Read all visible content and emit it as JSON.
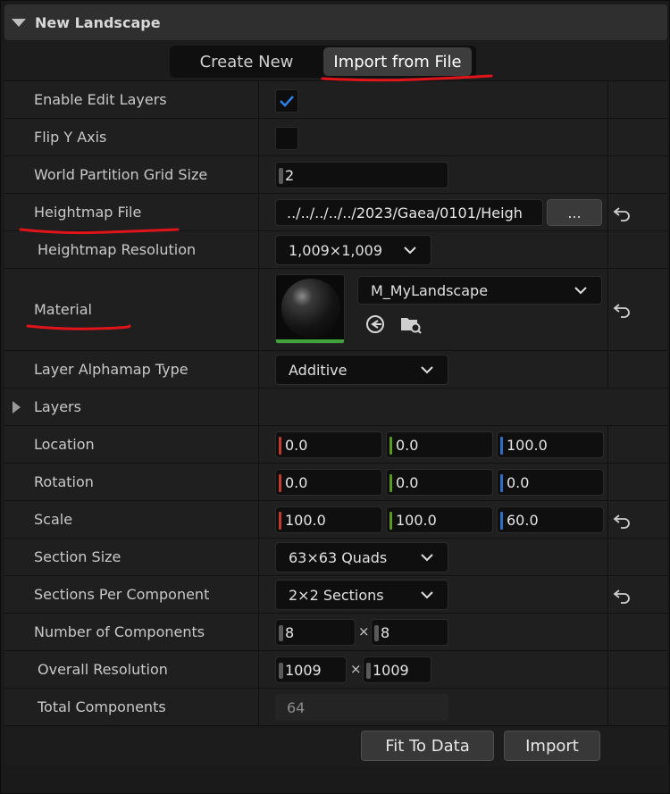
{
  "header": {
    "title": "New Landscape"
  },
  "tabs": [
    {
      "label": "Create New"
    },
    {
      "label": "Import from File"
    }
  ],
  "rows": {
    "enable_edit_layers": {
      "label": "Enable Edit Layers",
      "checked": true
    },
    "flip_y_axis": {
      "label": "Flip Y Axis",
      "checked": false
    },
    "wp_grid_size": {
      "label": "World Partition Grid Size",
      "value": "2"
    },
    "heightmap_file": {
      "label": "Heightmap File",
      "value": "../../../../../2023/Gaea/0101/Heigh",
      "browse_label": "..."
    },
    "heightmap_resolution": {
      "label": "Heightmap Resolution",
      "value": "1,009×1,009"
    },
    "material": {
      "label": "Material",
      "value": "M_MyLandscape"
    },
    "layer_alphamap_type": {
      "label": "Layer Alphamap Type",
      "value": "Additive"
    },
    "layers": {
      "label": "Layers"
    },
    "location": {
      "label": "Location",
      "x": "0.0",
      "y": "0.0",
      "z": "100.0"
    },
    "rotation": {
      "label": "Rotation",
      "x": "0.0",
      "y": "0.0",
      "z": "0.0"
    },
    "scale": {
      "label": "Scale",
      "x": "100.0",
      "y": "100.0",
      "z": "60.0"
    },
    "section_size": {
      "label": "Section Size",
      "value": "63×63 Quads"
    },
    "sections_per_component": {
      "label": "Sections Per Component",
      "value": "2×2 Sections"
    },
    "number_of_components": {
      "label": "Number of Components",
      "x": "8",
      "y": "8",
      "sep": "×"
    },
    "overall_resolution": {
      "label": "Overall Resolution",
      "x": "1009",
      "y": "1009",
      "sep": "×"
    },
    "total_components": {
      "label": "Total Components",
      "value": "64"
    }
  },
  "buttons": {
    "fit_to_data": "Fit To Data",
    "import": "Import"
  },
  "colors": {
    "accent_check": "#2c6fc9",
    "annotation": "#e0141a",
    "thumb_bar": "#3fa33a"
  },
  "icons": [
    "chevron-down-icon",
    "checkmark-icon",
    "reset-arrow-icon",
    "use-selected-asset-icon",
    "browse-asset-icon",
    "expand-arrow-icon"
  ]
}
